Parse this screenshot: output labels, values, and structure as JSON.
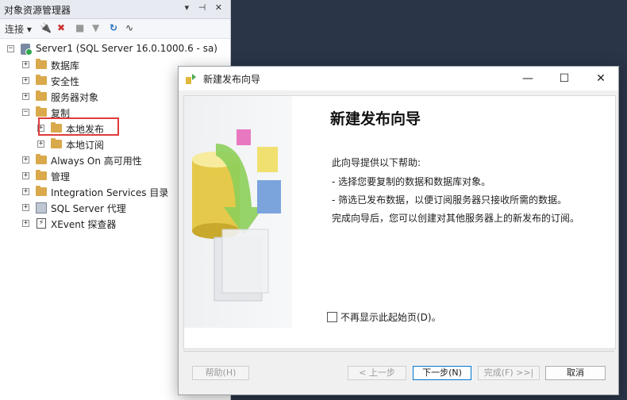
{
  "explorer": {
    "title": "对象资源管理器",
    "pin_controls": "▾ ⊣ ✕",
    "toolbar": {
      "connect": "连接"
    },
    "tree": {
      "server": "Server1 (SQL Server 16.0.1000.6 - sa)",
      "items": [
        "数据库",
        "安全性",
        "服务器对象",
        "复制",
        "本地发布",
        "本地订阅",
        "Always On 高可用性",
        "管理",
        "Integration Services 目录",
        "SQL Server 代理",
        "XEvent 探查器"
      ]
    }
  },
  "dialog": {
    "title": "新建发布向导",
    "heading": "新建发布向导",
    "intro": "此向导提供以下帮助:",
    "bullets": [
      "- 选择您要复制的数据和数据库对象。",
      "- 筛选已发布数据，以便订阅服务器只接收所需的数据。"
    ],
    "closing": "完成向导后，您可以创建对其他服务器上的新发布的订阅。",
    "checkbox": "不再显示此起始页(D)。",
    "buttons": {
      "help": "帮助(H)",
      "back": "< 上一步",
      "next": "下一步(N)",
      "finish": "完成(F) >>|",
      "cancel": "取消"
    }
  }
}
